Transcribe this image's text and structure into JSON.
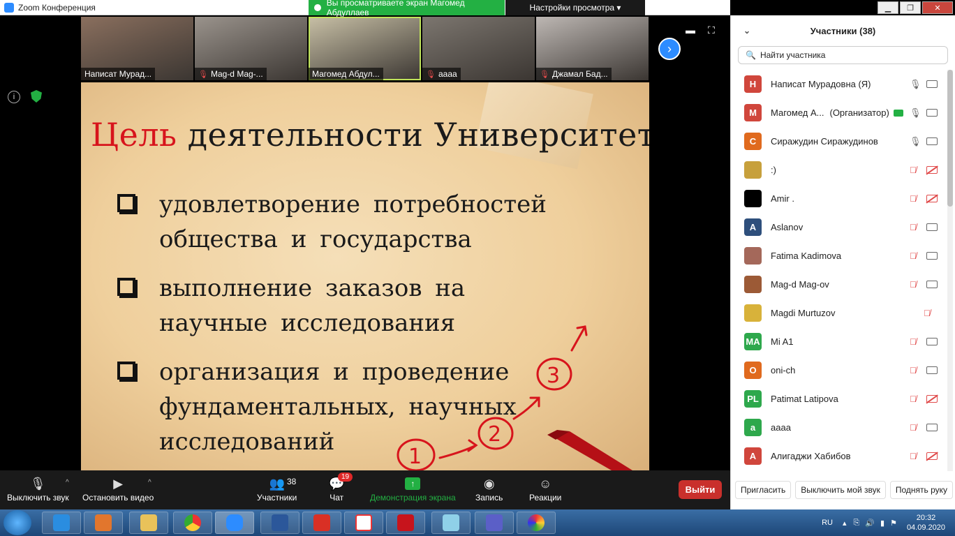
{
  "window": {
    "title": "Zoom Конференция",
    "share_banner": "Вы просматриваете экран Магомед Абдуллаев",
    "view_options": "Настройки просмотра ▾"
  },
  "video_strip": [
    {
      "name": "Написат Мурад...",
      "muted": false,
      "active": false,
      "bg": "#8a6f5e"
    },
    {
      "name": "Mag-d Mag-...",
      "muted": true,
      "active": false,
      "bg": "#9a938c"
    },
    {
      "name": "Магомед Абдул...",
      "muted": false,
      "active": true,
      "bg": "#c8c0a6"
    },
    {
      "name": "аааа",
      "muted": true,
      "active": false,
      "bg": "#7c766f"
    },
    {
      "name": "Джамал Бад...",
      "muted": true,
      "active": false,
      "bg": "#bdb7b3"
    }
  ],
  "slide": {
    "title_accent": "Цель",
    "title_rest": " деятельности Университета:",
    "bullets": [
      "удовлетворение потребностей общества и государства",
      "выполнение заказов на научные исследования",
      "организация и проведение фундаментальных, научных исследований"
    ],
    "steps": [
      "1",
      "2",
      "3"
    ]
  },
  "toolbar": {
    "mute_label": "Выключить звук",
    "video_label": "Остановить видео",
    "participants_label": "Участники",
    "participants_count": "38",
    "chat_label": "Чат",
    "chat_badge": "19",
    "share_label": "Демонстрация экрана",
    "record_label": "Запись",
    "reactions_label": "Реакции",
    "leave_label": "Выйти"
  },
  "panel": {
    "title": "Участники (38)",
    "search_placeholder": "Найти участника",
    "participants": [
      {
        "initials": "Н",
        "name": "Написат Мурадовна (Я)",
        "role": "",
        "color": "#d0463c",
        "mic_muted": false,
        "cam_off": false
      },
      {
        "initials": "М",
        "name": "Магомед А...",
        "role": "(Организатор)",
        "color": "#d0463c",
        "mic_muted": false,
        "cam_off": false,
        "host": true
      },
      {
        "initials": "С",
        "name": "Сиражудин Сиражудинов",
        "role": "",
        "color": "#e06a1e",
        "mic_muted": false,
        "cam_off": false
      },
      {
        "initials": "",
        "name": ":)",
        "role": "",
        "color": "#c7a03c",
        "mic_muted": true,
        "cam_off": true
      },
      {
        "initials": "",
        "name": "Amir .",
        "role": "",
        "color": "#000000",
        "mic_muted": true,
        "cam_off": true
      },
      {
        "initials": "A",
        "name": "Aslanov",
        "role": "",
        "color": "#2e4f7c",
        "mic_muted": true,
        "cam_off": false
      },
      {
        "initials": "",
        "name": "Fatima Kadimova",
        "role": "",
        "color": "#a4685a",
        "mic_muted": true,
        "cam_off": false
      },
      {
        "initials": "",
        "name": "Mag-d Mag-ov",
        "role": "",
        "color": "#9c5a36",
        "mic_muted": true,
        "cam_off": false
      },
      {
        "initials": "",
        "name": "Magdi Murtuzov",
        "role": "",
        "color": "#d8b23a",
        "mic_muted": true,
        "cam_off": false,
        "no_cam": true
      },
      {
        "initials": "MA",
        "name": "Mi A1",
        "role": "",
        "color": "#2ea84c",
        "mic_muted": true,
        "cam_off": false
      },
      {
        "initials": "O",
        "name": "oni-ch",
        "role": "",
        "color": "#e06a1e",
        "mic_muted": true,
        "cam_off": false
      },
      {
        "initials": "PL",
        "name": "Patimat Latipova",
        "role": "",
        "color": "#2ea84c",
        "mic_muted": true,
        "cam_off": true
      },
      {
        "initials": "a",
        "name": "аааа",
        "role": "",
        "color": "#2ea84c",
        "mic_muted": true,
        "cam_off": false
      },
      {
        "initials": "А",
        "name": "Алигаджи Хабибов",
        "role": "",
        "color": "#d0463c",
        "mic_muted": true,
        "cam_off": true
      }
    ],
    "invite_label": "Пригласить",
    "mute_me_label": "Выключить мой звук",
    "raise_hand_label": "Поднять руку"
  },
  "taskbar": {
    "lang": "RU",
    "time": "20:32",
    "date": "04.09.2020"
  }
}
